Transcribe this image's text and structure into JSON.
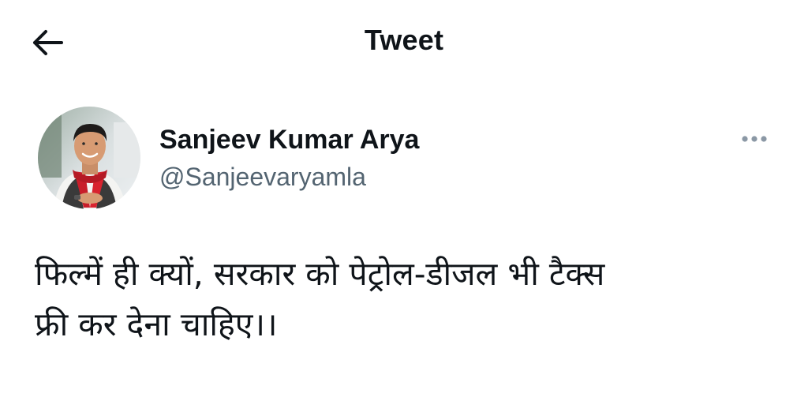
{
  "header": {
    "title": "Tweet",
    "back_icon": "arrow-left-icon"
  },
  "author": {
    "display_name": "Sanjeev Kumar Arya",
    "handle": "@Sanjeevaryamla",
    "avatar_icon": "user-avatar"
  },
  "more_icon": "more-horizontal-icon",
  "tweet": {
    "text": "फिल्में ही क्यों, सरकार को पेट्रोल-डीजल भी टैक्स\nफ्री कर देना चाहिए।।"
  },
  "colors": {
    "primary_text": "#0f1419",
    "secondary_text": "#536471",
    "more_dots": "#8b98a5",
    "avatar_scarf": "#c81e2a"
  }
}
